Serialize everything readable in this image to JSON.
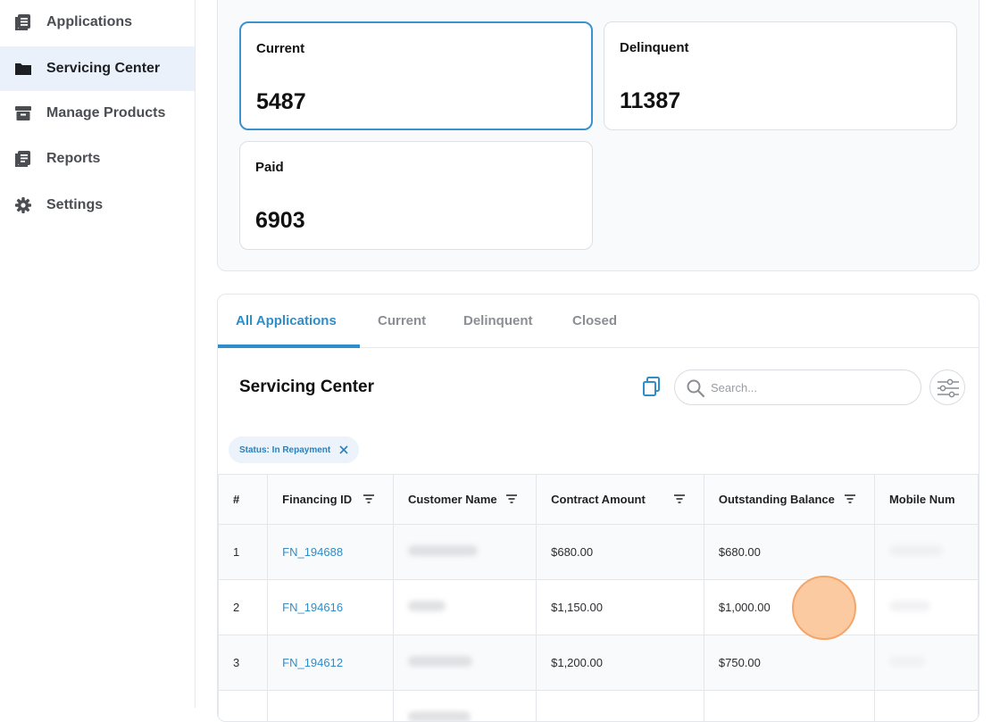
{
  "sidebar": {
    "items": [
      {
        "label": "Applications",
        "icon": "document-list-icon",
        "active": false
      },
      {
        "label": "Servicing Center",
        "icon": "folder-icon",
        "active": true
      },
      {
        "label": "Manage Products",
        "icon": "archive-box-icon",
        "active": false
      },
      {
        "label": "Reports",
        "icon": "report-icon",
        "active": false
      },
      {
        "label": "Settings",
        "icon": "gear-icon",
        "active": false
      }
    ]
  },
  "stats": {
    "current": {
      "label": "Current",
      "value": "5487"
    },
    "delinquent": {
      "label": "Delinquent",
      "value": "11387"
    },
    "paid": {
      "label": "Paid",
      "value": "6903"
    }
  },
  "tabs": [
    "All Applications",
    "Current",
    "Delinquent",
    "Closed"
  ],
  "active_tab": "All Applications",
  "section": {
    "title": "Servicing Center"
  },
  "search": {
    "placeholder": "Search..."
  },
  "filter_chip": {
    "label": "Status: In Repayment"
  },
  "table": {
    "columns": [
      "#",
      "Financing ID",
      "Customer Name",
      "Contract Amount",
      "Outstanding Balance",
      "Mobile Num"
    ],
    "rows": [
      {
        "num": "1",
        "financing_id": "FN_194688",
        "contract_amount": "$680.00",
        "outstanding_balance": "$680.00"
      },
      {
        "num": "2",
        "financing_id": "FN_194616",
        "contract_amount": "$1,150.00",
        "outstanding_balance": "$1,000.00"
      },
      {
        "num": "3",
        "financing_id": "FN_194612",
        "contract_amount": "$1,200.00",
        "outstanding_balance": "$750.00"
      },
      {
        "num": "",
        "financing_id": "",
        "contract_amount": "",
        "outstanding_balance": ""
      }
    ]
  },
  "colors": {
    "accent": "#2f8dc8",
    "active_nav_bg": "#eaf1fb",
    "cursor": "#fcc496"
  }
}
